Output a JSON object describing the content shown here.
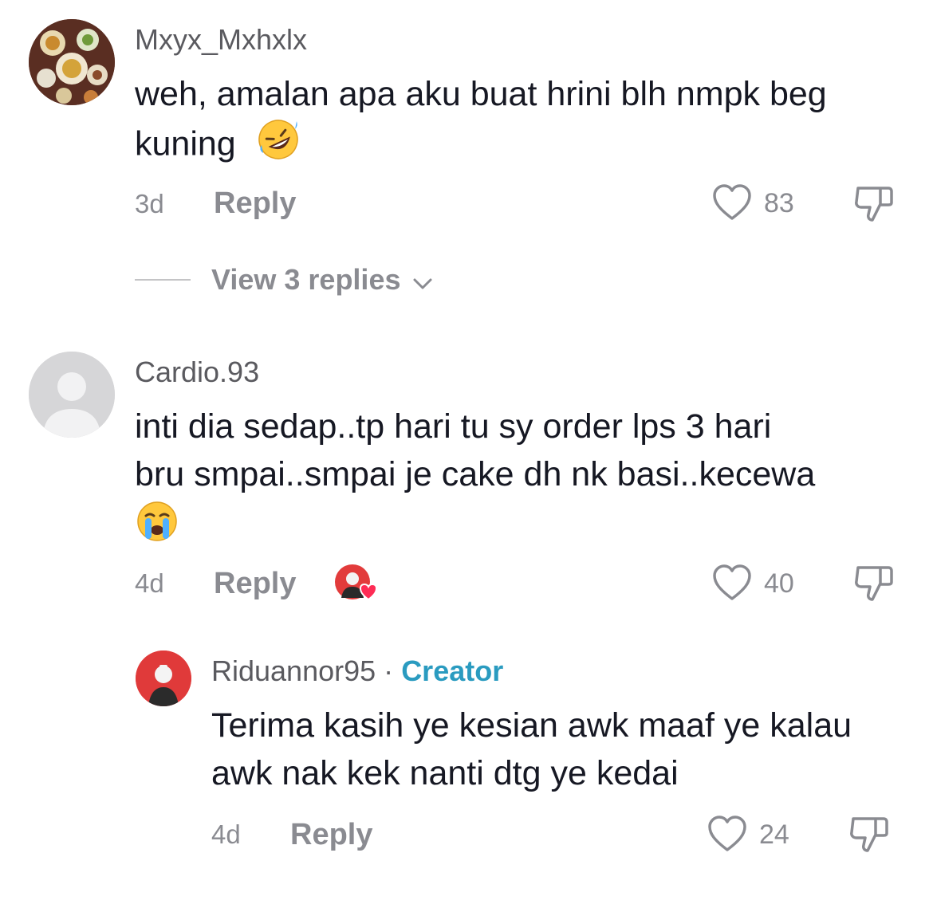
{
  "comments": [
    {
      "username": "Mxyx_Mxhxlx",
      "text_line1": "weh, amalan apa aku buat hrini blh nmpk beg",
      "text_line2": "kuning",
      "time": "3d",
      "reply_label": "Reply",
      "likes": "83",
      "view_replies": "View 3 replies"
    },
    {
      "username": "Cardio.93",
      "text_line1": "inti dia sedap..tp hari tu sy order lps 3 hari",
      "text_line2": "bru smpai..smpai je cake dh nk basi..kecewa",
      "time": "4d",
      "reply_label": "Reply",
      "likes": "40"
    }
  ],
  "reply": {
    "username": "Riduannor95",
    "separator": "·",
    "badge": "Creator",
    "text_line1": "Terima kasih ye kesian awk maaf ye kalau",
    "text_line2": "awk nak kek nanti dtg ye kedai",
    "time": "4d",
    "reply_label": "Reply",
    "likes": "24"
  },
  "colors": {
    "text": "#161823",
    "muted": "#8a8b91",
    "creator": "#2a9bc0",
    "heart_badge": "#fe2c55"
  }
}
